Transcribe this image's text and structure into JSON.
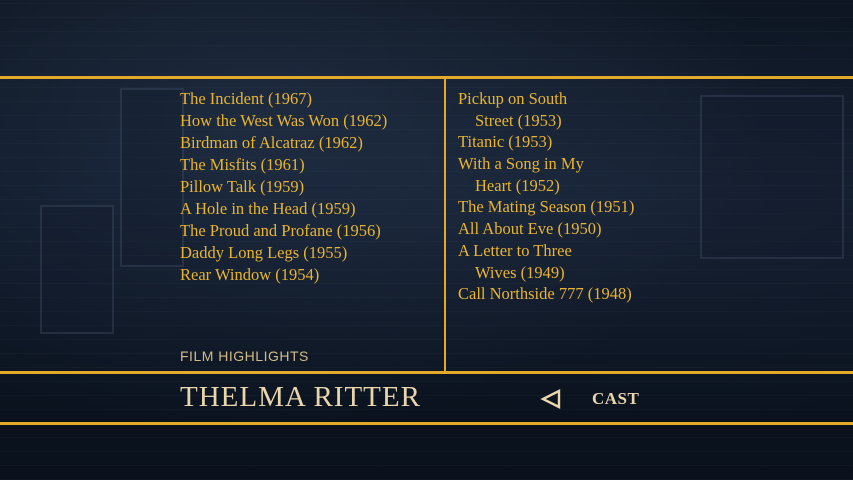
{
  "menu": {
    "left_films": [
      "The Incident (1967)",
      "How the West Was Won (1962)",
      "Birdman of Alcatraz (1962)",
      "The Misfits (1961)",
      "Pillow Talk (1959)",
      "A Hole in the Head (1959)",
      "The Proud and Profane (1956)",
      "Daddy Long Legs (1955)",
      "Rear Window (1954)"
    ],
    "right_films": [
      [
        "Pickup on South",
        "Street (1953)"
      ],
      [
        "Titanic (1953)"
      ],
      [
        "With a Song in My",
        "Heart (1952)"
      ],
      [
        "The Mating Season (1951)"
      ],
      [
        "All About Eve (1950)"
      ],
      [
        "A Letter to Three",
        "Wives (1949)"
      ],
      [
        "Call Northside 777 (1948)"
      ]
    ],
    "section_label": "FILM HIGHLIGHTS",
    "actor_name": "THELMA RITTER",
    "nav": {
      "back_label": "CAST",
      "icon": "triangle-left-icon"
    },
    "colors": {
      "accent": "#e3a92a",
      "text": "#e9b431",
      "title": "#e9d6ad"
    }
  }
}
